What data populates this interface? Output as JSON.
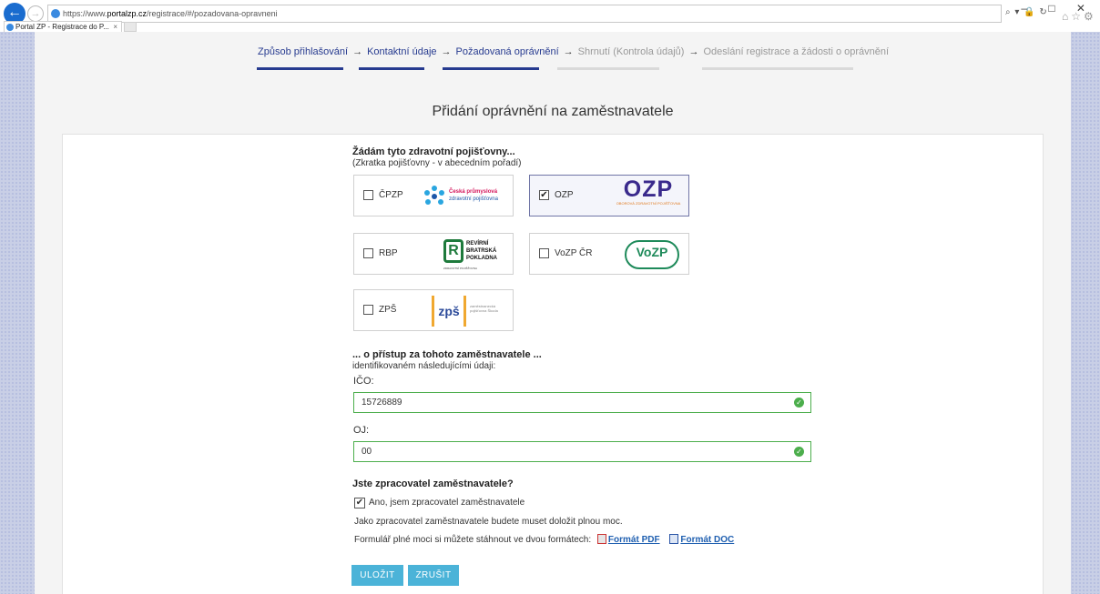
{
  "browser": {
    "url_prefix": "https://www.",
    "url_domain": "portalzp.cz",
    "url_path": "/registrace/#/pozadovana-opravneni",
    "addr_icons": "⌕ ▾ 🔒 ↻",
    "window_controls": "– □ ✕",
    "tab_title": "Portal ZP - Registrace do P...",
    "tab_close": "×"
  },
  "steps": [
    {
      "label": "Způsob přihlašování",
      "state": "done"
    },
    {
      "label": "Kontaktní údaje",
      "state": "done"
    },
    {
      "label": "Požadovaná oprávnění",
      "state": "active"
    },
    {
      "label": "Shrnutí (Kontrola údajů)",
      "state": "pending"
    },
    {
      "label": "Odeslání registrace a žádosti o oprávnění",
      "state": "pending"
    }
  ],
  "step_arrow": "→",
  "page_title": "Přidání oprávnění na zaměstnavatele",
  "insurers": {
    "heading": "Žádám tyto zdravotní pojišťovny...",
    "subheading": "(Zkratka pojišťovny - v abecedním pořadí)",
    "items": [
      {
        "label": "ČPZP",
        "checked": false,
        "logo_line1": "Česká průmyslová",
        "logo_line2": "zdravotní pojišťovna"
      },
      {
        "label": "OZP",
        "checked": true,
        "logo_line1": "OZP",
        "logo_line2": "OBOROVÁ ZDRAVOTNÍ POJIŠŤOVNA"
      },
      {
        "label": "RBP",
        "checked": false,
        "logo_line1": "REVÍRNÍ BRATRSKÁ POKLADNA",
        "logo_line2": "ZDRAVOTNÍ POJIŠŤOVNA"
      },
      {
        "label": "VoZP ČR",
        "checked": false,
        "logo_line1": "VoZP",
        "logo_line2": ""
      },
      {
        "label": "ZPŠ",
        "checked": false,
        "logo_line1": "zpš",
        "logo_line2": "zaměstnanecká pojišťovna Škoda"
      }
    ]
  },
  "employer": {
    "heading": "... o přístup za tohoto zaměstnavatele ...",
    "subheading": "identifikovaném následujícími údaji:",
    "ico_label": "IČO:",
    "ico_value": "15726889",
    "oj_label": "OJ:",
    "oj_value": "00",
    "valid_mark": "✓"
  },
  "processor": {
    "heading": "Jste zpracovatel zaměstnavatele?",
    "checkbox_label": "Ano, jsem zpracovatel zaměstnavatele",
    "checked": true,
    "check_mark": "✔",
    "note": "Jako zpracovatel zaměstnavatele budete muset doložit plnou moc.",
    "download_text": "Formulář plné moci si můžete stáhnout ve dvou formátech:",
    "pdf_link": "Formát PDF",
    "doc_link": "Formát DOC"
  },
  "buttons": {
    "save": "ULOŽIT",
    "cancel": "ZRUŠIT"
  },
  "colors": {
    "active_step": "#263a8f",
    "pending_step_bar": "#d9d9d9",
    "valid_green": "#4cae4c",
    "button": "#4bb3d8"
  }
}
